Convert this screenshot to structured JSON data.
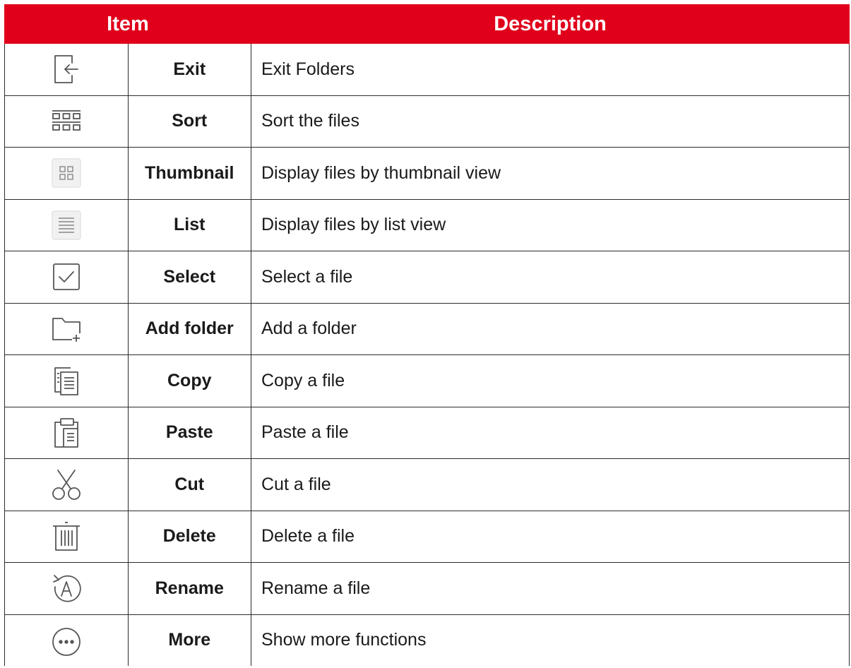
{
  "header": {
    "item": "Item",
    "description": "Description"
  },
  "rows": [
    {
      "icon": "exit-icon",
      "name": "Exit",
      "description": "Exit Folders"
    },
    {
      "icon": "sort-icon",
      "name": "Sort",
      "description": "Sort the files"
    },
    {
      "icon": "thumbnail-icon",
      "name": "Thumbnail",
      "description": "Display files by thumbnail view"
    },
    {
      "icon": "list-icon",
      "name": "List",
      "description": "Display files by list view"
    },
    {
      "icon": "select-icon",
      "name": "Select",
      "description": "Select a file"
    },
    {
      "icon": "add-folder-icon",
      "name": "Add folder",
      "description": "Add a folder"
    },
    {
      "icon": "copy-icon",
      "name": "Copy",
      "description": "Copy a file"
    },
    {
      "icon": "paste-icon",
      "name": "Paste",
      "description": "Paste a file"
    },
    {
      "icon": "cut-icon",
      "name": "Cut",
      "description": "Cut a file"
    },
    {
      "icon": "delete-icon",
      "name": "Delete",
      "description": "Delete a file"
    },
    {
      "icon": "rename-icon",
      "name": "Rename",
      "description": "Rename a file"
    },
    {
      "icon": "more-icon",
      "name": "More",
      "description": "Show more functions"
    }
  ],
  "colors": {
    "header_bg": "#e0001b",
    "header_text": "#ffffff",
    "border": "#2b2b2b",
    "icon_stroke": "#555555"
  }
}
